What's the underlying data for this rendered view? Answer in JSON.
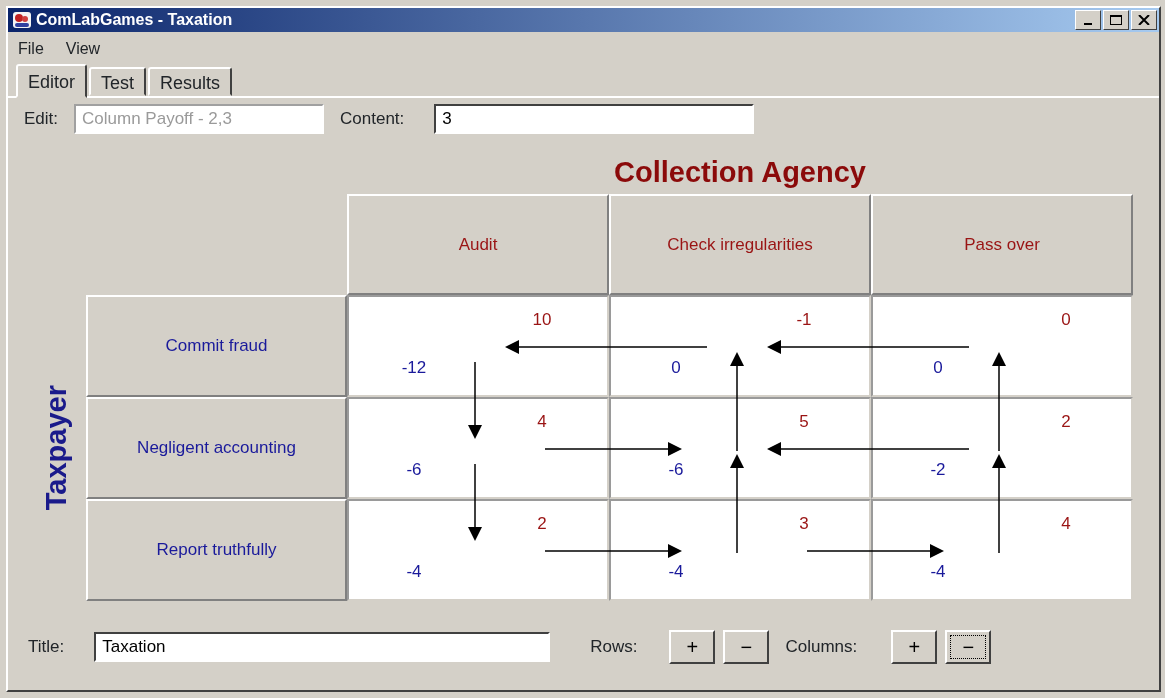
{
  "window": {
    "title": "ComLabGames - Taxation"
  },
  "menu": [
    {
      "label": "File"
    },
    {
      "label": "View"
    }
  ],
  "tabs": [
    {
      "label": "Editor",
      "selected": true
    },
    {
      "label": "Test",
      "selected": false
    },
    {
      "label": "Results",
      "selected": false
    }
  ],
  "edit_field": {
    "label": "Edit:",
    "value": "Column Payoff - 2,3",
    "disabled": true
  },
  "content_field": {
    "label": "Content:",
    "value": "3"
  },
  "game": {
    "column_player": "Collection Agency",
    "row_player": "Taxpayer",
    "columns": [
      {
        "label": "Audit",
        "vertical_arrows": [
          {
            "points_down": true
          },
          {
            "points_down": true
          }
        ]
      },
      {
        "label": "Check irregularities",
        "vertical_arrows": [
          {
            "points_down": false
          },
          {
            "points_down": false
          }
        ]
      },
      {
        "label": "Pass over",
        "vertical_arrows": [
          {
            "points_down": false
          },
          {
            "points_down": false
          }
        ]
      }
    ],
    "rows": [
      {
        "label": "Commit fraud",
        "horizontal_arrows": [
          {
            "points_right": false
          },
          {
            "points_right": false
          }
        ],
        "cells": [
          {
            "row_payoff": "-12",
            "column_payoff": "10"
          },
          {
            "row_payoff": "0",
            "column_payoff": "-1"
          },
          {
            "row_payoff": "0",
            "column_payoff": "0"
          }
        ]
      },
      {
        "label": "Negligent accounting",
        "horizontal_arrows": [
          {
            "points_right": true
          },
          {
            "points_right": false
          }
        ],
        "cells": [
          {
            "row_payoff": "-6",
            "column_payoff": "4"
          },
          {
            "row_payoff": "-6",
            "column_payoff": "5"
          },
          {
            "row_payoff": "-2",
            "column_payoff": "2"
          }
        ]
      },
      {
        "label": "Report truthfully",
        "horizontal_arrows": [
          {
            "points_right": true
          },
          {
            "points_right": true
          }
        ],
        "cells": [
          {
            "row_payoff": "-4",
            "column_payoff": "2"
          },
          {
            "row_payoff": "-4",
            "column_payoff": "3"
          },
          {
            "row_payoff": "-4",
            "column_payoff": "4"
          }
        ]
      }
    ]
  },
  "bottom": {
    "title_label": "Title:",
    "title_value": "Taxation",
    "rows_label": "Rows:",
    "rows_buttons": [
      {
        "label": "+",
        "focused": false
      },
      {
        "label": "−",
        "focused": false
      }
    ],
    "columns_label": "Columns:",
    "columns_buttons": [
      {
        "label": "+",
        "focused": false
      },
      {
        "label": "−",
        "focused": true
      }
    ]
  }
}
